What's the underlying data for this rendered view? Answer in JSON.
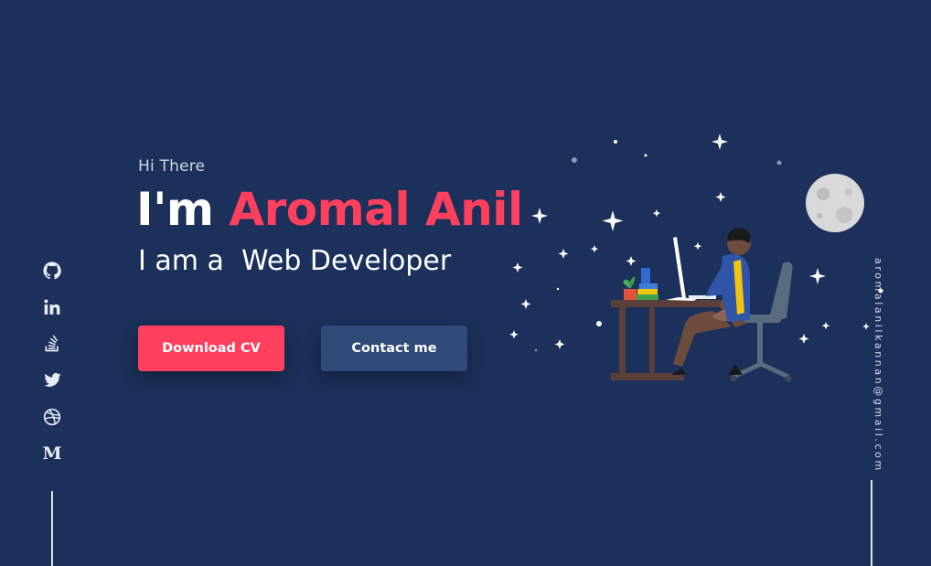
{
  "hero": {
    "greeting": "Hi There",
    "headline_prefix": "I'm ",
    "headline_name": "Aromal Anil",
    "role_prefix": "I am a  ",
    "role_title": "Web Developer",
    "primary_button": "Download CV",
    "secondary_button": "Contact me"
  },
  "social": [
    {
      "icon": "github-icon"
    },
    {
      "icon": "linkedin-icon"
    },
    {
      "icon": "stackoverflow-icon"
    },
    {
      "icon": "twitter-icon"
    },
    {
      "icon": "dribbble-icon"
    },
    {
      "icon": "medium-icon",
      "glyph": "M"
    }
  ],
  "email": "aromalanilkannan@gmail.com",
  "colors": {
    "background": "#1b305a",
    "accent": "#ff3f5e",
    "secondary_button": "#2f4a78",
    "text": "#ffffff"
  }
}
